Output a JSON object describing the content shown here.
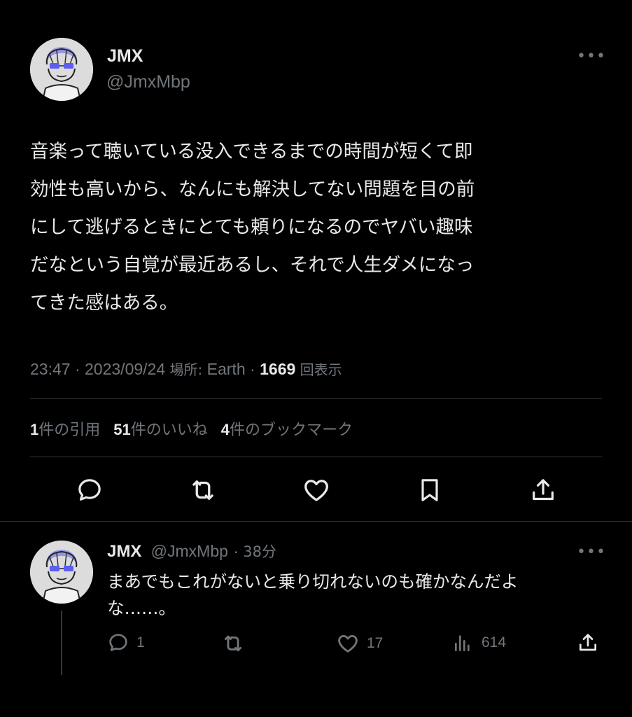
{
  "main_tweet": {
    "author": {
      "name": "JMX",
      "handle": "@JmxMbp"
    },
    "text": "音楽って聴いている没入できるまでの時間が短くて即\n効性も高いから、なんにも解決してない問題を目の前\nにして逃げるときにとても頼りになるのでヤバい趣味\nだなという自覚が最近あるし、それで人生ダメになっ\nてきた感はある。",
    "meta": {
      "time": "23:47",
      "date": "2023/09/24",
      "location_label": "場所:",
      "location": "Earth",
      "views": "1669",
      "views_label": "回表示"
    },
    "stats": {
      "quotes_count": "1",
      "quotes_label": "件の引用",
      "likes_count": "51",
      "likes_label": "件のいいね",
      "bookmarks_count": "4",
      "bookmarks_label": "件のブックマーク"
    },
    "actions": [
      "reply-icon",
      "retweet-icon",
      "like-icon",
      "bookmark-icon",
      "share-icon"
    ]
  },
  "reply_tweet": {
    "author": {
      "name": "JMX",
      "handle": "@JmxMbp"
    },
    "age": "38分",
    "text": "まあでもこれがないと乗り切れないのも確かなんだよ\nな……。",
    "counts": {
      "replies": "1",
      "retweets": "",
      "likes": "17",
      "views": "614"
    }
  },
  "colors": {
    "background": "#000000",
    "primary_text": "#e7e9ea",
    "secondary_text": "#71767b",
    "divider": "#2f3336",
    "avatar_bg": "#d9d9d9",
    "avatar_accent": "#5d5df0"
  }
}
